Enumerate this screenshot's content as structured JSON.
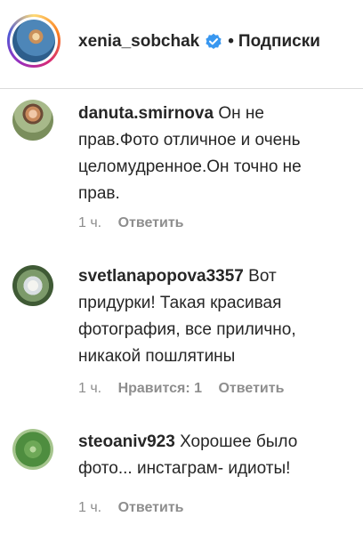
{
  "header": {
    "username": "xenia_sobchak",
    "separator": "•",
    "follow_status": "Подписки",
    "verified_icon": "verified-badge-icon",
    "verified_color": "#3897f0"
  },
  "comments": [
    {
      "username": "danuta.smirnova",
      "text": "Он не прав.Фото отличное и очень целомудренное.Он точно не прав.",
      "time": "1 ч.",
      "likes": "",
      "reply": "Ответить"
    },
    {
      "username": "svetlanapopova3357",
      "text": "Вот придурки! Такая красивая фотография, все прилично, никакой пошлятины",
      "time": "1 ч.",
      "likes": "Нравится: 1",
      "reply": "Ответить"
    },
    {
      "username": "steoaniv923",
      "text": "Хорошее было фото... инстаграм- идиоты!",
      "time": "1 ч.",
      "likes": "",
      "reply": "Ответить"
    }
  ]
}
